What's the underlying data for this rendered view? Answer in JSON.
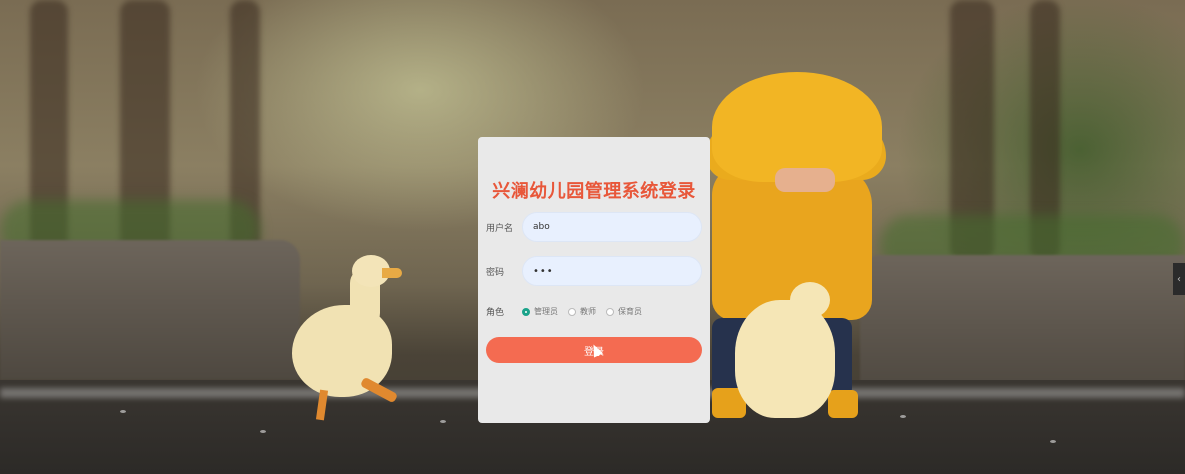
{
  "login": {
    "title": "兴澜幼儿园管理系统登录",
    "username_label": "用户名",
    "username_value": "abo",
    "password_label": "密码",
    "password_value": "•••",
    "role_label": "角色",
    "roles": [
      {
        "label": "管理员",
        "selected": true
      },
      {
        "label": "教师",
        "selected": false
      },
      {
        "label": "保育员",
        "selected": false
      }
    ],
    "submit_label": "登录"
  },
  "side_toggle_glyph": "‹",
  "colors": {
    "title": "#e8573a",
    "button": "#f46b51",
    "radio_selected": "#1aa38a",
    "input_bg": "#e8f0fe",
    "panel_bg": "#e9e9e9"
  }
}
